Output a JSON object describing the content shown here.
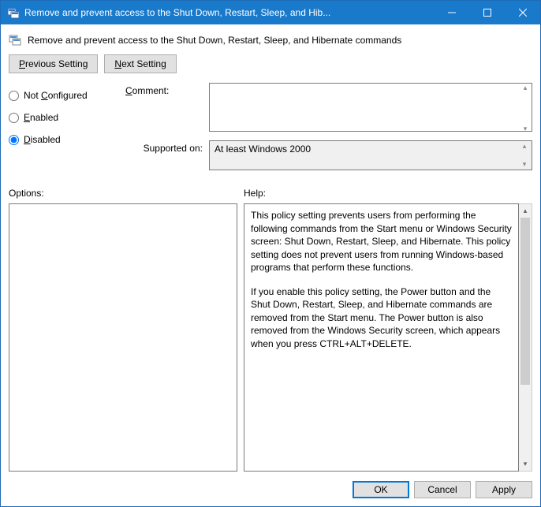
{
  "titlebar": {
    "text": "Remove and prevent access to the Shut Down, Restart, Sleep, and Hib..."
  },
  "heading": {
    "text": "Remove and prevent access to the Shut Down, Restart, Sleep, and Hibernate commands"
  },
  "nav": {
    "previous_pre": "P",
    "previous_rest": "revious Setting",
    "next_pre": "N",
    "next_rest": "ext Setting"
  },
  "state": {
    "not_configured_pre": "Not ",
    "not_configured_u": "C",
    "not_configured_rest": "onfigured",
    "enabled_u": "E",
    "enabled_rest": "nabled",
    "disabled_u": "D",
    "disabled_rest": "isabled",
    "selected": "disabled"
  },
  "fields": {
    "comment_label_u": "C",
    "comment_label_rest": "omment:",
    "comment_value": "",
    "supported_label": "Supported on:",
    "supported_value": "At least Windows 2000"
  },
  "panes": {
    "options_label": "Options:",
    "help_label": "Help:",
    "help_para1": "This policy setting prevents users from performing the following commands from the Start menu or Windows Security screen: Shut Down, Restart, Sleep, and Hibernate. This policy setting does not prevent users from running Windows-based programs that perform these functions.",
    "help_para2": "If you enable this policy setting, the Power button and the Shut Down, Restart, Sleep, and Hibernate commands are removed from the Start menu. The Power button is also removed from the Windows Security screen, which appears when you press CTRL+ALT+DELETE."
  },
  "footer": {
    "ok": "OK",
    "cancel": "Cancel",
    "apply": "Apply"
  }
}
